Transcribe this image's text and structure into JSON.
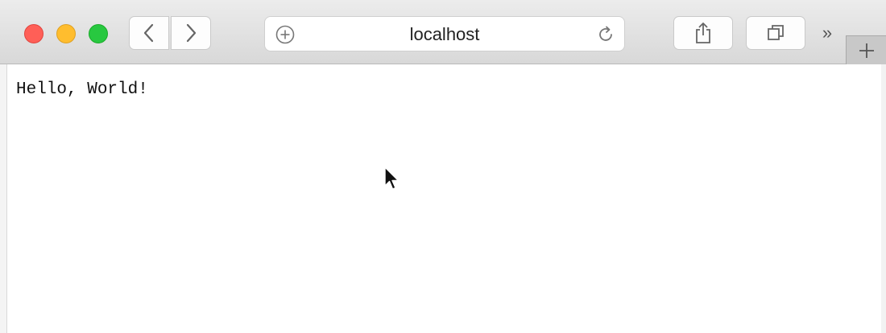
{
  "browser": {
    "address_bar": {
      "url": "localhost"
    },
    "icons": {
      "back": "chevron-left-icon",
      "forward": "chevron-right-icon",
      "share": "share-icon",
      "tabs": "tab-overview-icon",
      "overflow": "double-chevron-right-icon",
      "new_tab": "plus-icon",
      "reload": "reload-icon",
      "add_bookmark": "circle-plus-icon"
    },
    "overflow_glyph": "»",
    "colors": {
      "close": "#ff5f57",
      "minimize": "#ffbd2e",
      "zoom": "#28c840"
    }
  },
  "page": {
    "body_text": "Hello, World!"
  }
}
